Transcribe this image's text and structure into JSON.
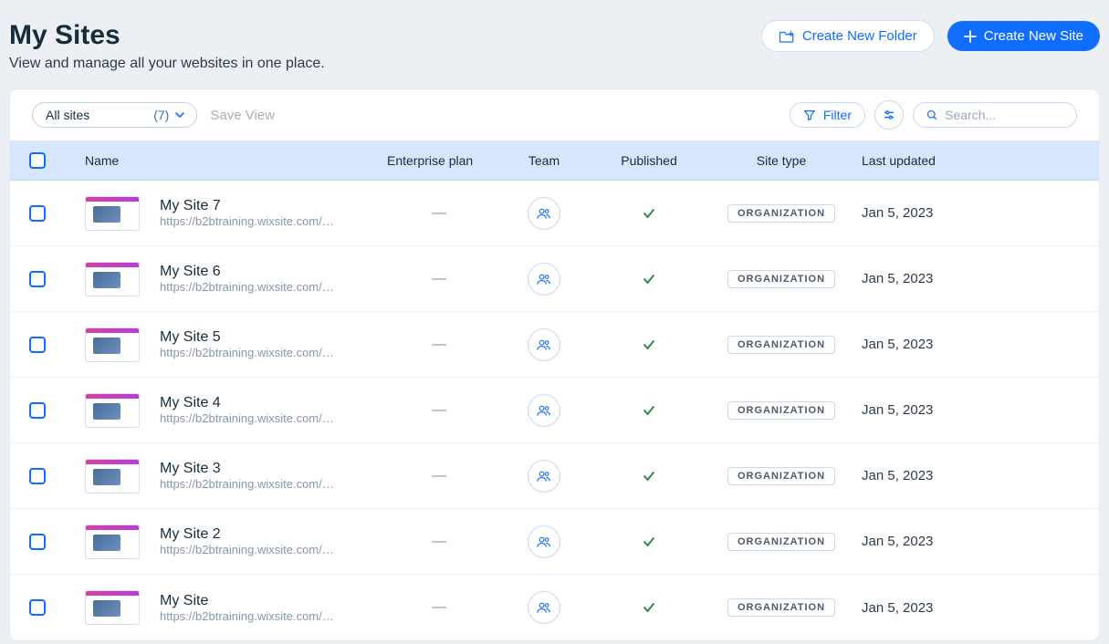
{
  "header": {
    "title": "My Sites",
    "subtitle": "View and manage all your websites in one place.",
    "create_folder_label": "Create New Folder",
    "create_site_label": "Create New Site"
  },
  "toolbar": {
    "filter_dropdown_label": "All sites",
    "filter_count": "(7)",
    "save_view_label": "Save View",
    "filter_btn_label": "Filter",
    "search_placeholder": "Search..."
  },
  "columns": {
    "name": "Name",
    "plan": "Enterprise plan",
    "team": "Team",
    "published": "Published",
    "site_type": "Site type",
    "last_updated": "Last updated"
  },
  "rows": [
    {
      "name": "My Site 7",
      "url": "https://b2btraining.wixsite.com/w…",
      "plan": "—",
      "published": true,
      "site_type": "ORGANIZATION",
      "last_updated": "Jan 5, 2023"
    },
    {
      "name": "My Site 6",
      "url": "https://b2btraining.wixsite.com/w…",
      "plan": "—",
      "published": true,
      "site_type": "ORGANIZATION",
      "last_updated": "Jan 5, 2023"
    },
    {
      "name": "My Site 5",
      "url": "https://b2btraining.wixsite.com/w…",
      "plan": "—",
      "published": true,
      "site_type": "ORGANIZATION",
      "last_updated": "Jan 5, 2023"
    },
    {
      "name": "My Site 4",
      "url": "https://b2btraining.wixsite.com/w…",
      "plan": "—",
      "published": true,
      "site_type": "ORGANIZATION",
      "last_updated": "Jan 5, 2023"
    },
    {
      "name": "My Site 3",
      "url": "https://b2btraining.wixsite.com/w…",
      "plan": "—",
      "published": true,
      "site_type": "ORGANIZATION",
      "last_updated": "Jan 5, 2023"
    },
    {
      "name": "My Site 2",
      "url": "https://b2btraining.wixsite.com/w…",
      "plan": "—",
      "published": true,
      "site_type": "ORGANIZATION",
      "last_updated": "Jan 5, 2023"
    },
    {
      "name": "My Site",
      "url": "https://b2btraining.wixsite.com/…",
      "plan": "—",
      "published": true,
      "site_type": "ORGANIZATION",
      "last_updated": "Jan 5, 2023"
    }
  ]
}
